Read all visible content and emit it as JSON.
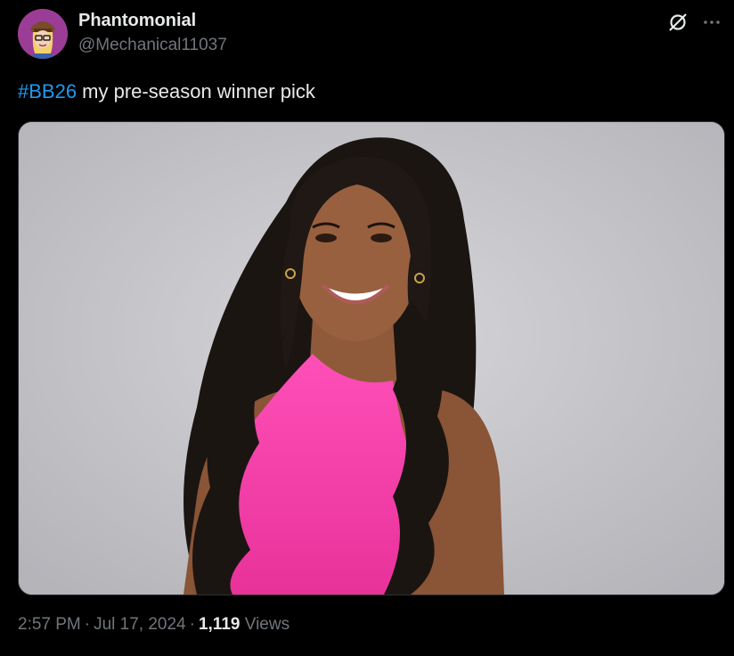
{
  "tweet": {
    "display_name": "Phantomonial",
    "handle": "@Mechanical11037",
    "hashtag": "#BB26",
    "text": " my pre-season winner pick",
    "time": "2:57 PM",
    "date": "Jul 17, 2024",
    "separator": "·",
    "views_count": "1,119",
    "views_label": "Views"
  },
  "icons": {
    "grok": "grok-icon",
    "more": "more-options-icon"
  },
  "colors": {
    "background": "#000000",
    "text": "#e7e9ea",
    "secondary": "#71767b",
    "link": "#1d9bf0",
    "dress": "#f43fa8"
  }
}
